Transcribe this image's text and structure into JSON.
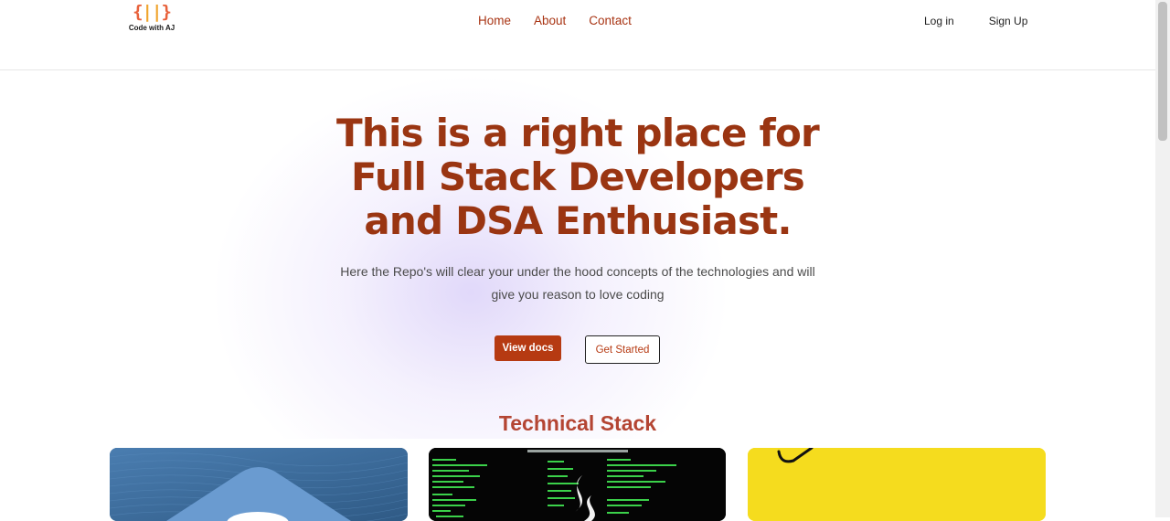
{
  "logo": {
    "mark_left": "{",
    "mark_mid": "||",
    "mark_right": "}",
    "text": "Code with AJ"
  },
  "nav": {
    "home": "Home",
    "about": "About",
    "contact": "Contact"
  },
  "auth": {
    "login": "Log in",
    "signup": "Sign Up"
  },
  "hero": {
    "title_line1": "This is a right place for",
    "title_line2": "Full Stack Developers",
    "title_line3": "and DSA Enthusiast.",
    "subtitle_line1": "Here the Repo's will clear your under the hood concepts of the technologies and will",
    "subtitle_line2": "give you reason to love coding",
    "primary_button": "View docs",
    "secondary_button": "Get Started"
  },
  "section": {
    "title": "Technical Stack"
  },
  "colors": {
    "accent": "#b63a12",
    "title": "#9a3512",
    "nav_link": "#a83413",
    "section_title": "#b44533",
    "card_blue": "#3f6f9c",
    "card_dark": "#050505",
    "card_yellow": "#f5dc1e"
  },
  "cards": [
    {
      "icon": "js-hexagon-icon"
    },
    {
      "icon": "java-code-icon"
    },
    {
      "icon": "js-yellow-icon"
    }
  ]
}
